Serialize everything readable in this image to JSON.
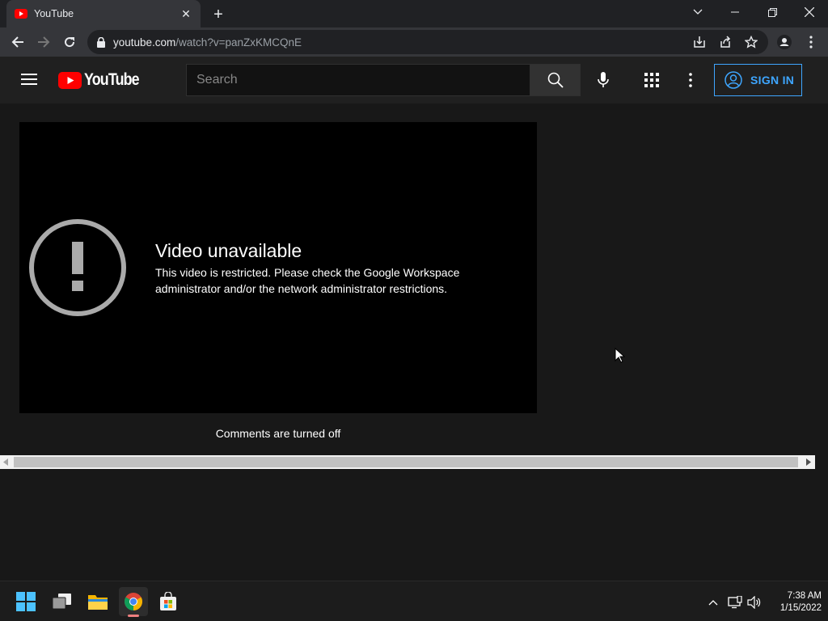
{
  "browser": {
    "tab": {
      "title": "YouTube",
      "close_glyph": "✕"
    },
    "new_tab_glyph": "+",
    "url_host": "youtube.com",
    "url_rest": "/watch?v=panZxKMCQnE",
    "icons": [
      "back-arrow-icon",
      "forward-arrow-icon",
      "reload-icon",
      "lock-icon",
      "install-app-icon",
      "share-icon",
      "star-icon",
      "profile-icon",
      "kebab-menu-icon"
    ]
  },
  "youtube": {
    "logo_text": "YouTube",
    "search_placeholder": "Search",
    "signin_label": "SIGN IN",
    "accent": "#3ea6ff",
    "logo_red": "#ff0000"
  },
  "player": {
    "error_title": "Video unavailable",
    "error_message": "This video is restricted. Please check the Google Workspace administrator and/or the network administrator restrictions."
  },
  "comments_text": "Comments are turned off",
  "taskbar": {
    "time": "7:38 AM",
    "date": "1/15/2022",
    "apps": [
      "start-icon",
      "task-view-icon",
      "file-explorer-icon",
      "chrome-icon",
      "store-icon"
    ]
  }
}
